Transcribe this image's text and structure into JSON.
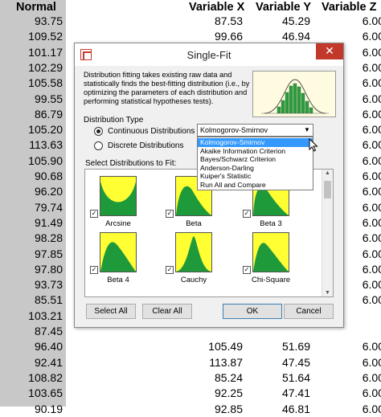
{
  "sheet": {
    "headers": {
      "normal": "Normal",
      "var_x": "Variable X",
      "var_y": "Variable Y",
      "var_z": "Variable Z"
    },
    "normal_col": [
      "93.75",
      "109.52",
      "101.17",
      "102.29",
      "105.58",
      "99.55",
      "86.79",
      "105.20",
      "113.63",
      "105.90",
      "90.68",
      "96.20",
      "79.74",
      "91.49",
      "98.28",
      "97.85",
      "97.80",
      "93.73",
      "85.51",
      "103.21",
      "87.45",
      "96.40",
      "92.41",
      "108.82",
      "103.65",
      "90.19"
    ],
    "rows_right": [
      {
        "x": "87.53",
        "y": "45.29",
        "z": "6.00"
      },
      {
        "x": "99.66",
        "y": "46.94",
        "z": "6.00"
      },
      {
        "x": "105.49",
        "y": "51.69",
        "z": "6.00"
      },
      {
        "x": "113.87",
        "y": "47.45",
        "z": "6.00"
      },
      {
        "x": "85.24",
        "y": "51.64",
        "z": "6.00"
      },
      {
        "x": "92.25",
        "y": "47.41",
        "z": "6.00"
      },
      {
        "x": "92.85",
        "y": "46.81",
        "z": "6.00"
      }
    ],
    "z_col_hidden": [
      "6.00",
      "6.00",
      "6.00",
      "6.00",
      "6.00",
      "6.00",
      "6.00",
      "6.00",
      "6.00",
      "6.00",
      "6.00",
      "6.00",
      "6.00",
      "6.00",
      "6.00",
      "6.00",
      "6.00"
    ]
  },
  "dialog": {
    "title": "Single-Fit",
    "close_glyph": "✕",
    "description": "Distribution fitting takes existing raw data and statistically finds the best-fitting distribution (i.e., by optimizing the parameters of each distribution and performing statistical hypotheses tests).",
    "distribution_type_label": "Distribution Type",
    "continuous_label": "Continuous Distributions",
    "discrete_label": "Discrete Distributions",
    "selected_type": "continuous",
    "method_selected": "Kolmogorov-Smirnov",
    "method_options": [
      "Kolmogorov-Smirnov",
      "Akaike Information Criterion",
      "Bayes/Schwarz Criterion",
      "Anderson-Darling",
      "Kuiper's Statistic",
      "Run All and Compare"
    ],
    "select_label": "Select Distributions to Fit:",
    "distributions": [
      {
        "name": "Arcsine",
        "checked": true,
        "shape": "arcsine"
      },
      {
        "name": "Beta",
        "checked": true,
        "shape": "beta"
      },
      {
        "name": "Beta 3",
        "checked": true,
        "shape": "beta3"
      },
      {
        "name": "Beta 4",
        "checked": true,
        "shape": "beta4"
      },
      {
        "name": "Cauchy",
        "checked": true,
        "shape": "cauchy"
      },
      {
        "name": "Chi-Square",
        "checked": true,
        "shape": "chisq"
      }
    ],
    "buttons": {
      "select_all": "Select All",
      "clear_all": "Clear All",
      "ok": "OK",
      "cancel": "Cancel"
    },
    "colors": {
      "thumb_bg": "#ffff33",
      "thumb_fill": "#1f9a3a",
      "accent": "#3399ff",
      "close": "#c0392b"
    }
  }
}
